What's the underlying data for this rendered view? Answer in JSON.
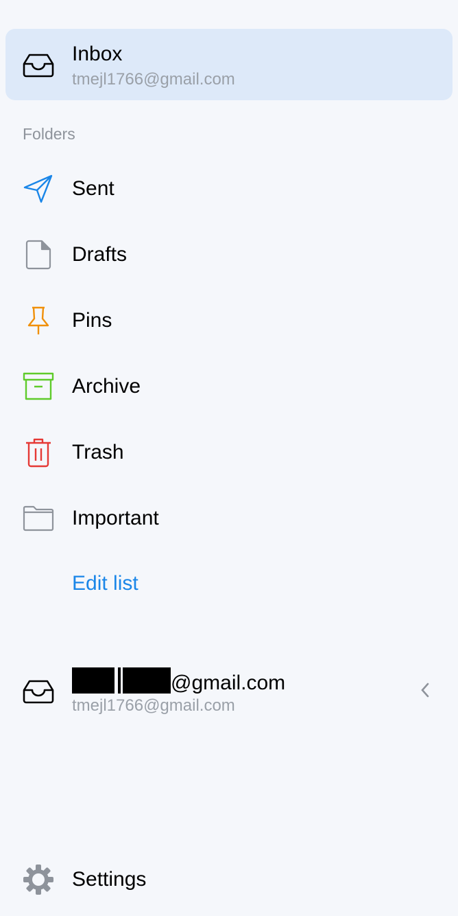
{
  "inbox": {
    "title": "Inbox",
    "account": "tmejl1766@gmail.com",
    "icon": "inbox-icon"
  },
  "folders_header": "Folders",
  "folders": [
    {
      "label": "Sent",
      "icon": "send-icon",
      "color": "#1a86e8"
    },
    {
      "label": "Drafts",
      "icon": "document-icon",
      "color": "#8e939b"
    },
    {
      "label": "Pins",
      "icon": "pin-icon",
      "color": "#f0900a"
    },
    {
      "label": "Archive",
      "icon": "archive-icon",
      "color": "#5fcb2b"
    },
    {
      "label": "Trash",
      "icon": "trash-icon",
      "color": "#e53935"
    },
    {
      "label": "Important",
      "icon": "folder-icon",
      "color": "#8e939b"
    }
  ],
  "edit_list": "Edit list",
  "account": {
    "name_suffix": "@gmail.com",
    "email": "tmejl1766@gmail.com"
  },
  "settings": "Settings"
}
